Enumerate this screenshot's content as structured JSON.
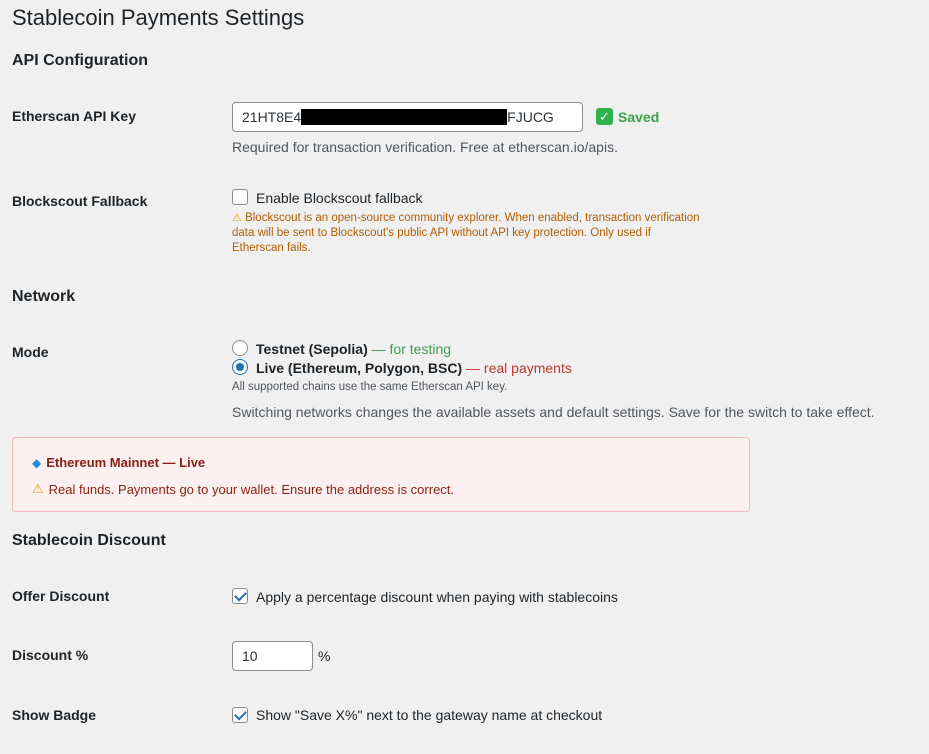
{
  "page": {
    "title": "Stablecoin Payments Settings"
  },
  "api": {
    "heading": "API Configuration",
    "etherscan_label": "Etherscan API Key",
    "key_prefix": "21HT8E4",
    "key_suffix": "FJUCG",
    "saved_label": "Saved",
    "key_description": "Required for transaction verification. Free at etherscan.io/apis.",
    "blockscout_label": "Blockscout Fallback",
    "blockscout_checkbox_label": "Enable Blockscout fallback",
    "blockscout_checked": false,
    "blockscout_warning": "Blockscout is an open-source community explorer. When enabled, transaction verification data will be sent to Blockscout's public API without API key protection. Only used if Etherscan fails."
  },
  "network": {
    "heading": "Network",
    "mode_label": "Mode",
    "testnet_label": "Testnet (Sepolia)",
    "testnet_note": "— for testing",
    "live_label": "Live (Ethereum, Polygon, BSC)",
    "live_note": "— real payments",
    "selected": "live",
    "chains_note": "All supported chains use the same Etherscan API key.",
    "switch_description": "Switching networks changes the available assets and default settings. Save for the switch to take effect.",
    "alert_title": "Ethereum Mainnet — Live",
    "alert_message": "Real funds. Payments go to your wallet. Ensure the address is correct."
  },
  "discount": {
    "heading": "Stablecoin Discount",
    "offer_label": "Offer Discount",
    "offer_checkbox_label": "Apply a percentage discount when paying with stablecoins",
    "offer_checked": true,
    "percent_label": "Discount %",
    "percent_value": "10",
    "percent_unit": "%",
    "badge_label": "Show Badge",
    "badge_checkbox_label": "Show \"Save X%\" next to the gateway name at checkout",
    "badge_checked": true
  },
  "colors": {
    "background": "#f0f0f1",
    "accent": "#2271b1",
    "saved_green": "#3aa34a",
    "warning_orange": "#b35d00",
    "alert_bg": "#fcf0f1",
    "alert_text": "#8a1f11"
  },
  "icons": {
    "saved": "check-mark-icon",
    "warning": "warning-icon",
    "network": "gem-icon"
  }
}
